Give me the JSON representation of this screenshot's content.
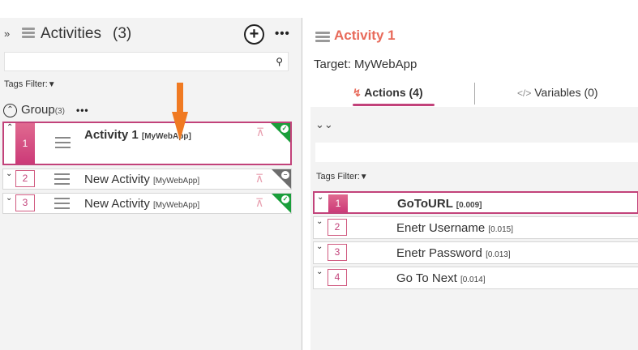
{
  "left_panel": {
    "title": "Activities",
    "count": "(3)",
    "add_icon": "plus-circle-icon",
    "more_icon": "ellipsis-icon",
    "search": {
      "value": "",
      "placeholder": ""
    },
    "tags_filter_label": "Tags Filter:",
    "group": {
      "label": "Group",
      "count": "(3)"
    },
    "activities": [
      {
        "number": "1",
        "name": "Activity 1",
        "target": "[MyWebApp]",
        "selected": true,
        "status": "success"
      },
      {
        "number": "2",
        "name": "New Activity",
        "target": "[MyWebApp]",
        "selected": false,
        "status": "disabled"
      },
      {
        "number": "3",
        "name": "New Activity",
        "target": "[MyWebApp]",
        "selected": false,
        "status": "success"
      }
    ]
  },
  "right_panel": {
    "title": "Activity 1",
    "target_label": "Target: MyWebApp",
    "tabs": [
      {
        "label": "Actions (4)",
        "icon": "bolt-icon",
        "active": true
      },
      {
        "label": "Variables (0)",
        "icon": "code-icon",
        "active": false
      }
    ],
    "search": {
      "value": "",
      "placeholder": ""
    },
    "tags_filter_label": "Tags Filter:",
    "actions": [
      {
        "number": "1",
        "name": "GoToURL",
        "time": "[0.009]",
        "selected": true
      },
      {
        "number": "2",
        "name": "Enetr Username",
        "time": "[0.015]",
        "selected": false
      },
      {
        "number": "3",
        "name": "Enetr Password",
        "time": "[0.013]",
        "selected": false
      },
      {
        "number": "4",
        "name": "Go To Next",
        "time": "[0.014]",
        "selected": false
      }
    ]
  },
  "colors": {
    "accent": "#c2427a",
    "title_orange": "#e86a5a",
    "status_green": "#1a9e3b",
    "status_gray": "#6d6d6d",
    "annotation_arrow": "#f07a22"
  }
}
